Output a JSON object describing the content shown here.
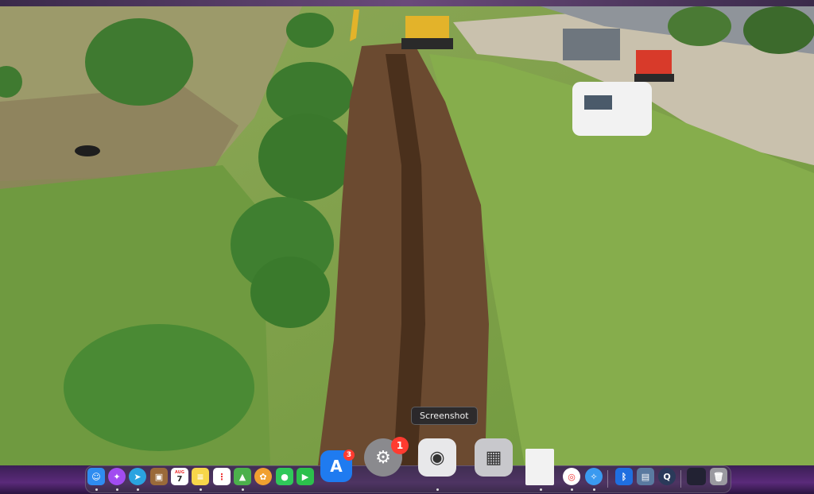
{
  "tooltip": {
    "text": "Screenshot"
  },
  "dock": {
    "apps": [
      {
        "name": "Finder",
        "icon": "finder-icon",
        "color": "#2f8cf0"
      },
      {
        "name": "Messenger",
        "icon": "messenger-icon",
        "color": "#a14cf0"
      },
      {
        "name": "Telegram",
        "icon": "telegram-icon",
        "color": "#2aa3e0"
      },
      {
        "name": "Notes Book",
        "icon": "brown-book-icon",
        "color": "#9a6a3a"
      },
      {
        "name": "Calendar",
        "icon": "calendar-icon",
        "color": "#ffffff",
        "month": "AUG",
        "day": "7"
      },
      {
        "name": "Notes",
        "icon": "notes-icon",
        "color": "#f7d64a"
      },
      {
        "name": "Reminders",
        "icon": "reminders-icon",
        "color": "#ffffff"
      },
      {
        "name": "Maps",
        "icon": "maps-icon",
        "color": "#4cb04c"
      },
      {
        "name": "Photos",
        "icon": "photos-icon",
        "color": "#f0a030"
      },
      {
        "name": "Messages",
        "icon": "messages-icon",
        "color": "#30c85a"
      },
      {
        "name": "FaceTime",
        "icon": "facetime-icon",
        "color": "#2cc04c"
      },
      {
        "name": "App Store",
        "icon": "app-store-icon",
        "color": "#1f7bf0",
        "badge": "3"
      },
      {
        "name": "System Settings",
        "icon": "settings-gear-icon",
        "color": "#8a8a8e",
        "badge": "1"
      },
      {
        "name": "Screenshot",
        "icon": "screenshot-camera-icon",
        "color": "#e8e8ea"
      },
      {
        "name": "Calculator",
        "icon": "calculator-icon",
        "color": "#c8c8cc"
      },
      {
        "name": "Document",
        "icon": "document-icon",
        "color": "#f2f2f2"
      },
      {
        "name": "Chrome",
        "icon": "chrome-icon",
        "color": "#ffffff"
      },
      {
        "name": "Safari",
        "icon": "safari-icon",
        "color": "#3a9af0"
      },
      {
        "name": "Bluetooth",
        "icon": "bluetooth-icon",
        "color": "#1f6fe0"
      },
      {
        "name": "Image Viewer",
        "icon": "image-viewer-icon",
        "color": "#5a7aa0"
      },
      {
        "name": "QuickTime",
        "icon": "quicktime-icon",
        "color": "#2a3a5a"
      },
      {
        "name": "Window",
        "icon": "window-thumbnail-icon",
        "color": "#222233"
      },
      {
        "name": "Trash",
        "icon": "trash-icon",
        "color": "#9a9aa0"
      }
    ]
  }
}
